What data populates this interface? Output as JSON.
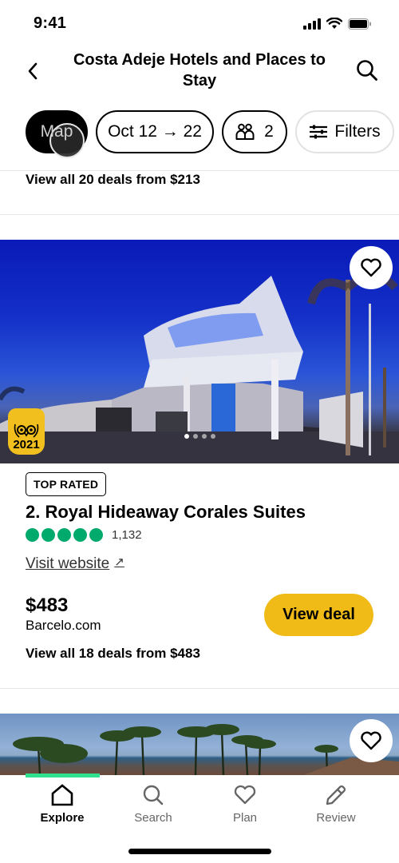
{
  "status_bar": {
    "time": "9:41"
  },
  "header": {
    "title": "Costa Adeje Hotels and Places to Stay",
    "back_icon": "chevron-left-icon",
    "search_icon": "search-icon"
  },
  "chips": {
    "map": "Map",
    "dates": "Oct 12 → 22",
    "guests": "2",
    "filters": "Filters"
  },
  "previous_listing": {
    "deals_text": "View all 20 deals from $213"
  },
  "listing": {
    "award_year": "2021",
    "badge": "TOP RATED",
    "name": "2. Royal Hideaway Corales Suites",
    "rating_bubbles": 5,
    "review_count": "1,132",
    "visit_website": "Visit website",
    "price": "$483",
    "provider": "Barcelo.com",
    "view_deal": "View deal",
    "all_deals": "View all 18 deals from $483",
    "photo_count": 4,
    "active_photo": 1
  },
  "colors": {
    "rating": "#00aa6c",
    "cta": "#f0bb17",
    "accent": "#2fe08f",
    "award": "#f2c01e"
  },
  "tabbar": {
    "items": [
      {
        "label": "Explore",
        "icon": "home-icon",
        "active": true
      },
      {
        "label": "Search",
        "icon": "search-icon",
        "active": false
      },
      {
        "label": "Plan",
        "icon": "heart-icon",
        "active": false
      },
      {
        "label": "Review",
        "icon": "pencil-icon",
        "active": false
      }
    ]
  }
}
